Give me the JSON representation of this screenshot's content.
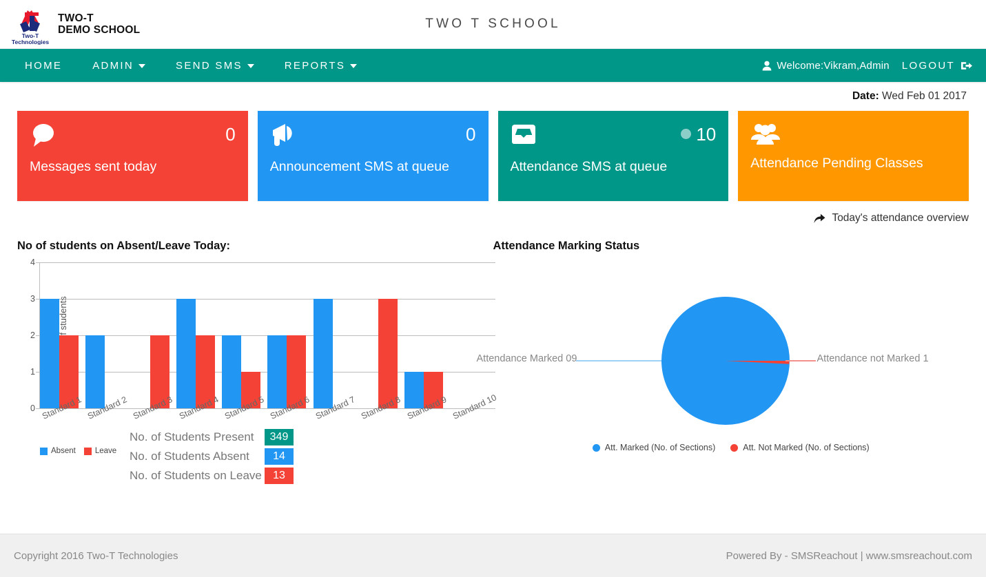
{
  "header": {
    "brand_line1": "TWO-T",
    "brand_line2": "DEMO SCHOOL",
    "logo_text_top": "Two-T",
    "logo_text_bottom": "Technologies",
    "school_title": "TWO T SCHOOL"
  },
  "nav": {
    "items": [
      {
        "label": "HOME",
        "has_caret": false
      },
      {
        "label": "ADMIN",
        "has_caret": true
      },
      {
        "label": "SEND SMS",
        "has_caret": true
      },
      {
        "label": "REPORTS",
        "has_caret": true
      }
    ],
    "welcome": "Welcome:Vikram,Admin",
    "logout": "LOGOUT"
  },
  "date": {
    "label": "Date:",
    "value": "Wed Feb 01 2017"
  },
  "cards": [
    {
      "value": "0",
      "label": "Messages sent today",
      "icon": "comment-icon",
      "color": "#f44336",
      "has_dot": false
    },
    {
      "value": "0",
      "label": "Announcement SMS at queue",
      "icon": "bullhorn-icon",
      "color": "#2196f3",
      "has_dot": false
    },
    {
      "value": "10",
      "label": "Attendance SMS at queue",
      "icon": "inbox-icon",
      "color": "#009688",
      "has_dot": true
    },
    {
      "value": "",
      "label": "Attendance Pending Classes",
      "icon": "users-icon",
      "color": "#ff9800",
      "has_dot": false
    }
  ],
  "overview_link": "Today's attendance overview",
  "counts": [
    {
      "label": "No. of Students Present",
      "value": "349",
      "color": "#009688"
    },
    {
      "label": "No. of Students Absent",
      "value": "14",
      "color": "#2196f3"
    },
    {
      "label": "No. of Students on Leave",
      "value": "13",
      "color": "#f44336"
    }
  ],
  "footer": {
    "copyright": "Copyright 2016 Two-T Technologies",
    "powered": "Powered By - SMSReachout",
    "separator": "|",
    "website": "www.smsreachout.com"
  },
  "chart_data": [
    {
      "type": "bar",
      "title": "No of students on Absent/Leave Today:",
      "xlabel": "",
      "ylabel": "Number of students",
      "ylim": [
        0,
        4
      ],
      "yticks": [
        0,
        1,
        2,
        3,
        4
      ],
      "grid": true,
      "legend_position": "bottom-left",
      "categories": [
        "Standard 1",
        "Standard 2",
        "Standard 3",
        "Standard 4",
        "Standard 5",
        "Standard 6",
        "Standard 7",
        "Standard 8",
        "Standard 9",
        "Standard 10"
      ],
      "series": [
        {
          "name": "Absent",
          "color": "#2196f3",
          "values": [
            3,
            2,
            0,
            3,
            2,
            2,
            3,
            0,
            1,
            0
          ]
        },
        {
          "name": "Leave",
          "color": "#f44336",
          "values": [
            2,
            0,
            2,
            2,
            1,
            2,
            0,
            3,
            1,
            0
          ]
        }
      ]
    },
    {
      "type": "pie",
      "title": "Attendance Marking Status",
      "legend_position": "bottom",
      "labels": [
        "Attendance Marked 09",
        "Attendance not Marked 1"
      ],
      "values": [
        9,
        1
      ],
      "colors": [
        "#2196f3",
        "#f44336"
      ],
      "legend": [
        {
          "name": "Att. Marked (No. of Sections)",
          "color": "#2196f3"
        },
        {
          "name": "Att. Not Marked (No. of Sections)",
          "color": "#f44336"
        }
      ]
    }
  ]
}
